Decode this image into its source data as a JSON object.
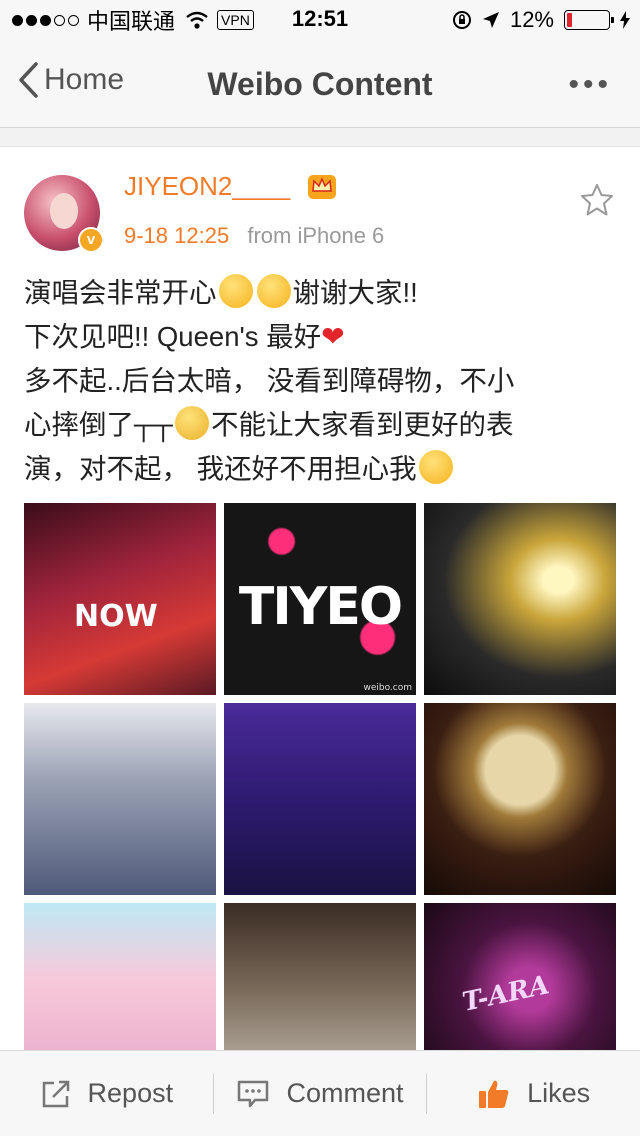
{
  "status_bar": {
    "carrier": "中国联通",
    "vpn": "VPN",
    "time": "12:51",
    "battery": "12%",
    "battery_level": 0.12,
    "battery_color": "#e0262d"
  },
  "nav": {
    "back_label": "Home",
    "title": "Weibo Content",
    "more_label": "•••"
  },
  "post": {
    "author": "JIYEON2____",
    "verified_mark": "v",
    "time": "9-18 12:25",
    "source": "from iPhone 6",
    "line1": "演唱会非常开心",
    "line1b": "谢谢大家!!",
    "line2": "下次见吧!! Queen's 最好",
    "heart": "❤",
    "line3": "多不起..后台太暗， 没看到障碍物，不小",
    "line4a": "心摔倒了┬┬",
    "line4b": "不能让大家看到更好的表",
    "line5": "演，对不起， 我还好不用担心我"
  },
  "photos": {
    "p2_text": "TIYEO",
    "p1_text": "NOW",
    "p9_text": "T-ARA",
    "watermark": "weibo.com"
  },
  "toolbar": {
    "repost": "Repost",
    "comment": "Comment",
    "likes": "Likes",
    "accent": "#f27b2a"
  }
}
